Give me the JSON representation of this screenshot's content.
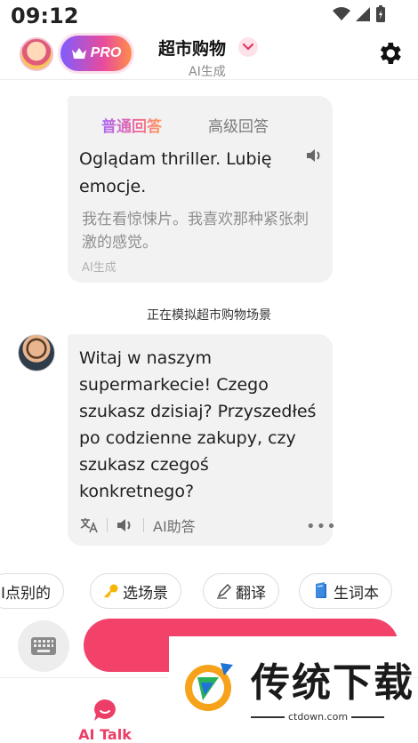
{
  "status_bar": {
    "time": "09:12"
  },
  "header": {
    "pro_label": "PRO",
    "title": "超市购物",
    "subtitle": "AI生成"
  },
  "tutor_bubble": {
    "tab_basic": "普通回答",
    "tab_advanced": "高级回答",
    "text": "Oglądam thriller. Lubię emocje.",
    "translation": "我在看惊悚片。我喜欢那种紧张刺激的感觉。",
    "ai_note": "AI生成"
  },
  "scenario_note": "正在模拟超市购物场景",
  "ai_bubble": {
    "text": "Witaj w naszym supermarkecie! Czego szukasz dzisiaj? Przyszedłeś po codzienne zakupy, czy szukasz czegoś konkretnego?",
    "assist_label": "AI助答",
    "more": "•••"
  },
  "chips": [
    {
      "label": "I点别的",
      "icon": ""
    },
    {
      "label": "选场景",
      "icon": "key-icon"
    },
    {
      "label": "翻译",
      "icon": "pen-icon"
    },
    {
      "label": "生词本",
      "icon": "book-icon"
    }
  ],
  "bottom_nav": {
    "ai_talk": "AI Talk"
  },
  "watermark": {
    "title": "传统下载",
    "url": "ctdown.com"
  },
  "colors": {
    "accent": "#f2426a",
    "bubble": "#f2f2f2",
    "muted": "#8e8e8e"
  }
}
